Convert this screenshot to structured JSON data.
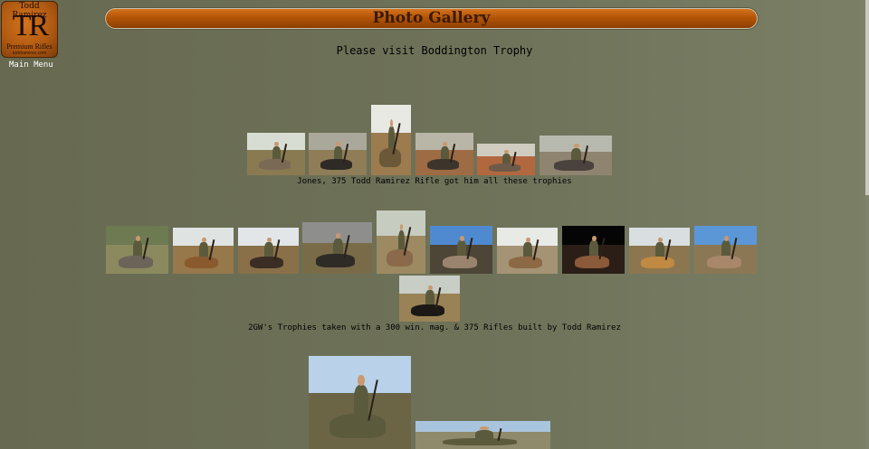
{
  "logo": {
    "top_text": "Todd Ramirez",
    "monogram": "TR",
    "sub_text": "Premium Rifles",
    "url_text": "toddramirez.com"
  },
  "nav": {
    "main_menu": "Main Menu"
  },
  "header": {
    "title": "Photo Gallery"
  },
  "visit_text": "Please visit Boddington Trophy",
  "sections": [
    {
      "caption": "Jones, 375 Todd Ramirez Rifle got him all these trophies"
    },
    {
      "caption": "2GW's Trophies taken with a 300 win. mag. & 375 Rifles built by Todd Ramirez"
    }
  ],
  "colors": {
    "background": "#6f735a",
    "title_bar": "#b35508",
    "title_text": "#3a1a04",
    "menu_text": "#ffffff"
  }
}
